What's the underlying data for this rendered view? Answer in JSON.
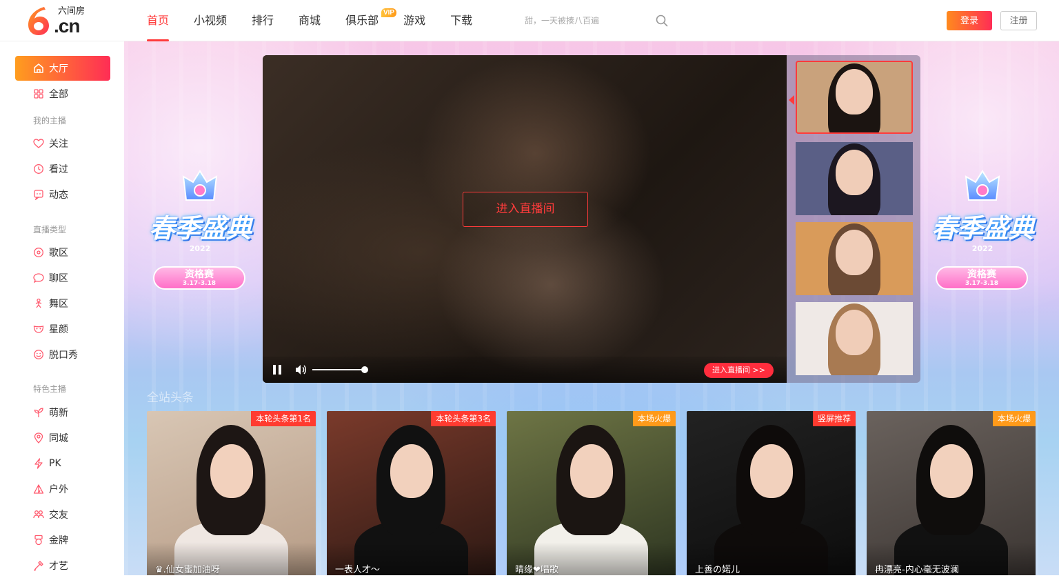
{
  "header": {
    "brand_text": "六间房",
    "logo_domain": ".cn",
    "nav": [
      {
        "label": "首页",
        "active": true
      },
      {
        "label": "小视频"
      },
      {
        "label": "排行"
      },
      {
        "label": "商城"
      },
      {
        "label": "俱乐部",
        "badge": "VIP"
      },
      {
        "label": "游戏"
      },
      {
        "label": "下载"
      }
    ],
    "search_placeholder": "甜，一天被揍八百遍",
    "login_label": "登录",
    "register_label": "注册"
  },
  "sidebar": {
    "items_top": [
      {
        "label": "大厅",
        "icon": "home-icon",
        "active": true
      },
      {
        "label": "全部",
        "icon": "grid-icon"
      }
    ],
    "group_my": "我的主播",
    "items_my": [
      {
        "label": "关注",
        "icon": "heart-icon"
      },
      {
        "label": "看过",
        "icon": "clock-icon"
      },
      {
        "label": "动态",
        "icon": "feed-icon"
      }
    ],
    "group_type": "直播类型",
    "items_type": [
      {
        "label": "歌区",
        "icon": "music-icon"
      },
      {
        "label": "聊区",
        "icon": "chat-icon"
      },
      {
        "label": "舞区",
        "icon": "dance-icon"
      },
      {
        "label": "星颜",
        "icon": "mask-icon"
      },
      {
        "label": "脱口秀",
        "icon": "talkshow-icon"
      }
    ],
    "group_feature": "特色主播",
    "items_feature": [
      {
        "label": "萌新",
        "icon": "sprout-icon"
      },
      {
        "label": "同城",
        "icon": "location-icon"
      },
      {
        "label": "PK",
        "icon": "lightning-icon"
      },
      {
        "label": "户外",
        "icon": "tent-icon"
      },
      {
        "label": "交友",
        "icon": "people-icon"
      },
      {
        "label": "金牌",
        "icon": "medal-icon"
      },
      {
        "label": "才艺",
        "icon": "palette-icon"
      }
    ]
  },
  "banner": {
    "emblem_title": "春季盛典",
    "emblem_year": "2022",
    "emblem_pill": "资格赛",
    "emblem_dates": "3.17-3.18"
  },
  "player": {
    "enter_label": "进入直播间",
    "enter_small_label": "进入直播间 >>",
    "volume_level": 1.0,
    "thumbnails": [
      {
        "active": true,
        "bg": "#c9a27c",
        "hair": "#1b1411"
      },
      {
        "active": false,
        "bg": "#5a5f86",
        "hair": "#1c1720"
      },
      {
        "active": false,
        "bg": "#d99b5a",
        "hair": "#6b4a34"
      },
      {
        "active": false,
        "bg": "#efe9e6",
        "hair": "#a87a52"
      }
    ]
  },
  "section_title": "全站头条",
  "cards": [
    {
      "title": "♛.仙女蜜加油呀",
      "tag": "本轮头条第1名",
      "tag_color": "#ff3b30",
      "bg1": "#d8c6b4",
      "bg2": "#b59a84",
      "hair": "#1d1614",
      "body": "#efe7e2"
    },
    {
      "title": "一表人才～",
      "tag": "本轮头条第3名",
      "tag_color": "#ff3b30",
      "bg1": "#7a3a2b",
      "bg2": "#2b1813",
      "hair": "#111",
      "body": "#111"
    },
    {
      "title": "晴缘❤唱歌",
      "tag": "本场火爆",
      "tag_color": "#ff9a1a",
      "bg1": "#6e7545",
      "bg2": "#2c3420",
      "hair": "#1b1512",
      "body": "#f2f0ea"
    },
    {
      "title": "上善の婼儿",
      "tag": "竖屏推荐",
      "tag_color": "#ff3b30",
      "bg1": "#222",
      "bg2": "#0c0c0c",
      "hair": "#0e0b0a",
      "body": "#0e0b0a"
    },
    {
      "title": "冉漂亮-内心毫无波澜",
      "tag": "本场火爆",
      "tag_color": "#ff9a1a",
      "bg1": "#6a625d",
      "bg2": "#3a3431",
      "hair": "#0f0d0c",
      "body": "#111"
    }
  ]
}
